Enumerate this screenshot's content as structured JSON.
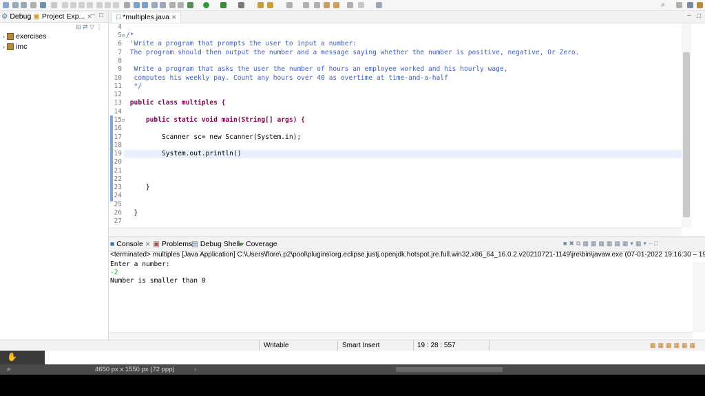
{
  "left_panel": {
    "tabs": [
      {
        "label": "Debug"
      },
      {
        "label": "Project Exp..."
      }
    ],
    "tree": [
      {
        "label": "exercises"
      },
      {
        "label": "imc"
      }
    ]
  },
  "editor": {
    "tab_label": "*multiples.java",
    "lines": [
      {
        "n": "4",
        "t": ""
      },
      {
        "n": "5",
        "t": "/*"
      },
      {
        "n": "6",
        "t": " 'Write a program that prompts the user to input a number:"
      },
      {
        "n": "7",
        "t": " The program should then output the number and a message saying whether the number is positive, negative, Or Zero."
      },
      {
        "n": "8",
        "t": ""
      },
      {
        "n": "9",
        "t": "  Write a program that asks the user the number of hours an employee worked and his hourly wage,"
      },
      {
        "n": "10",
        "t": "  computes his weekly pay. Count any hours over 40 as overtime at time-and-a-half"
      },
      {
        "n": "11",
        "t": "  */"
      },
      {
        "n": "12",
        "t": ""
      },
      {
        "n": "13",
        "t": " public class multiples {"
      },
      {
        "n": "14",
        "t": ""
      },
      {
        "n": "15",
        "t": "     public static void main(String[] args) {"
      },
      {
        "n": "16",
        "t": ""
      },
      {
        "n": "17",
        "t": "         Scanner sc= new Scanner(System.in);"
      },
      {
        "n": "18",
        "t": ""
      },
      {
        "n": "19",
        "t": "         System.out.println()"
      },
      {
        "n": "20",
        "t": ""
      },
      {
        "n": "21",
        "t": ""
      },
      {
        "n": "22",
        "t": ""
      },
      {
        "n": "23",
        "t": "     }"
      },
      {
        "n": "24",
        "t": ""
      },
      {
        "n": "25",
        "t": ""
      },
      {
        "n": "26",
        "t": "  }"
      },
      {
        "n": "27",
        "t": ""
      }
    ]
  },
  "console": {
    "tabs": [
      {
        "label": "Console"
      },
      {
        "label": "Problems"
      },
      {
        "label": "Debug Shell"
      },
      {
        "label": "Coverage"
      }
    ],
    "description": "<terminated> multiples [Java Application] C:\\Users\\flore\\.p2\\pool\\plugins\\org.eclipse.justj.openjdk.hotspot.jre.full.win32.x86_64_16.0.2.v20210721-1149\\jre\\bin\\javaw.exe  (07-01-2022 19:16:30 – 19:16:3",
    "output": [
      {
        "text": "Enter a number:",
        "color": "#000000"
      },
      {
        "text": "-2",
        "color": "#2a9a3a"
      },
      {
        "text": "Number is smaller than 0",
        "color": "#000000"
      }
    ]
  },
  "status": {
    "writable": "Writable",
    "insert_mode": "Smart Insert",
    "position": "19 : 28 : 557"
  },
  "image_info": {
    "text": "4650 px x 1550 px (72 ppp)"
  },
  "colors": {
    "keyword": "#7f0055",
    "comment": "#3f5fbf",
    "input_text": "#2a9a3a"
  }
}
